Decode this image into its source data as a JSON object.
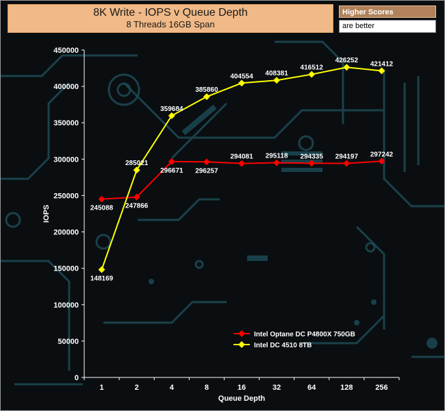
{
  "header": {
    "title": "8K Write - IOPS v Queue Depth",
    "subtitle": "8 Threads 16GB Span"
  },
  "note": {
    "line1": "Higher Scores",
    "line2": "are better"
  },
  "colors": {
    "series1": "#ff0000",
    "series2": "#ffff00",
    "title_bg": "#f0b987",
    "circuit": "#1f4f5a"
  },
  "chart_data": {
    "type": "line",
    "categories": [
      "1",
      "2",
      "4",
      "8",
      "16",
      "32",
      "64",
      "128",
      "256"
    ],
    "xlabel": "Queue Depth",
    "ylabel": "IOPS",
    "ylim": [
      0,
      450000
    ],
    "yticks": [
      "0",
      "50000",
      "100000",
      "150000",
      "200000",
      "250000",
      "300000",
      "350000",
      "400000",
      "450000"
    ],
    "grid": false,
    "legend_position": "bottom-center",
    "series": [
      {
        "name": "Intel Optane DC P4800X 750GB",
        "color": "#ff0000",
        "values": [
          245088,
          247866,
          296671,
          296257,
          294081,
          295118,
          294335,
          294197,
          297242
        ],
        "labels": [
          "245088",
          "247866",
          "296671",
          "296257",
          "294081",
          "295118",
          "294335",
          "294197",
          "297242"
        ]
      },
      {
        "name": "Intel DC 4510 8TB",
        "color": "#ffff00",
        "values": [
          148169,
          285021,
          359684,
          385860,
          404554,
          408381,
          416512,
          426252,
          421412
        ],
        "labels": [
          "148169",
          "285021",
          "359684",
          "385860",
          "404554",
          "408381",
          "416512",
          "426252",
          "421412"
        ]
      }
    ]
  }
}
